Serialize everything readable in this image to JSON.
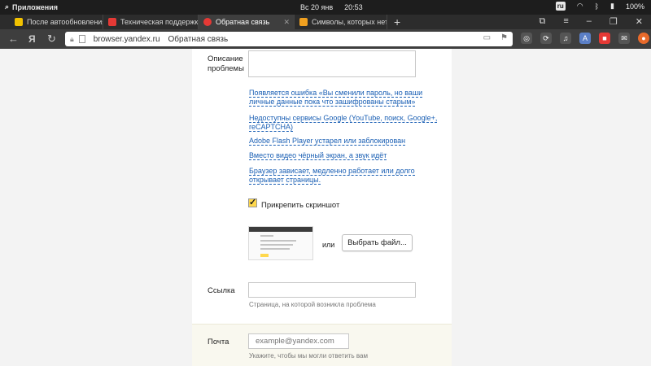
{
  "system_bar": {
    "apps_label": "Приложения",
    "date": "Вс 20 янв",
    "time": "20:53",
    "lang": "ru",
    "battery": "100%"
  },
  "tabs": [
    {
      "title": "После автообновления",
      "active": false,
      "favicon_color": "#f2c200"
    },
    {
      "title": "Техническая поддержка",
      "active": false,
      "favicon_color": "#e53935"
    },
    {
      "title": "Обратная связь",
      "active": true,
      "favicon_color": "#e53935"
    },
    {
      "title": "Символы, которых нет",
      "active": false,
      "favicon_color": "#f0a020"
    }
  ],
  "address_bar": {
    "host": "browser.yandex.ru",
    "page_title": "Обратная связь"
  },
  "form": {
    "description_label": "Описание проблемы",
    "suggestions": [
      "Появляется ошибка «Вы сменили пароль, но ваши личные данные пока что зашифрованы старым»",
      "Недоступны сервисы Google (YouTube, поиск, Google+, reCAPTCHA)",
      "Adobe Flash Player устарел или заблокирован",
      "Вместо видео чёрный экран, а звук идёт",
      "Браузер зависает, медленно работает или долго открывает страницы."
    ],
    "attach_screenshot_label": "Прикрепить скриншот",
    "attach_checked": true,
    "or_label": "или",
    "choose_file_label": "Выбрать файл...",
    "link_label": "Ссылка",
    "link_hint": "Страница, на которой возникла проблема",
    "email_label": "Почта",
    "email_placeholder": "example@yandex.com",
    "email_hint": "Укажите, чтобы мы могли ответить вам"
  }
}
